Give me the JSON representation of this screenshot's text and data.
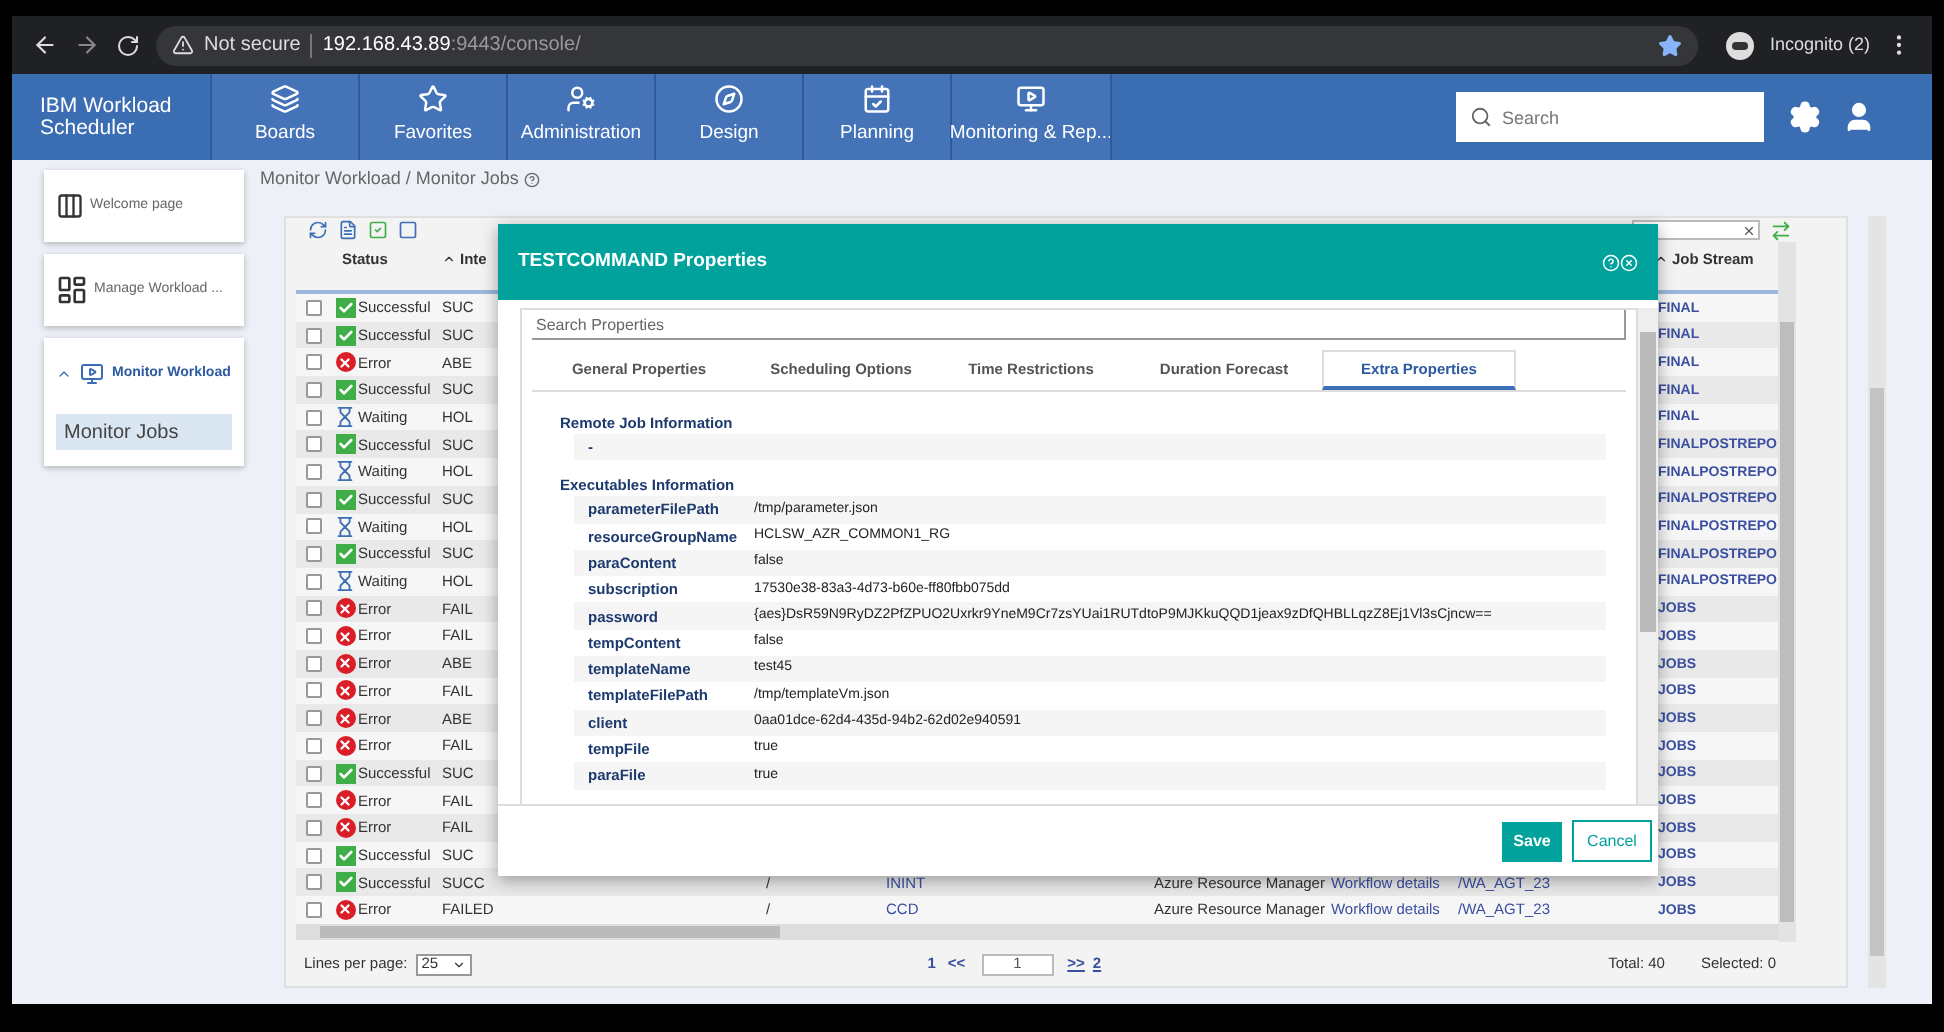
{
  "browser": {
    "security": "Not secure",
    "host": "192.168.43.89",
    "path": ":9443/console/",
    "profile": "Incognito (2)"
  },
  "app": {
    "name": "IBM Workload Scheduler"
  },
  "nav": [
    {
      "label": "Boards",
      "kind": "boards"
    },
    {
      "label": "Favorites",
      "kind": "favorites"
    },
    {
      "label": "Administration",
      "kind": "administration"
    },
    {
      "label": "Design",
      "kind": "design"
    },
    {
      "label": "Planning",
      "kind": "planning"
    },
    {
      "label": "Monitoring & Rep...",
      "kind": "monitoring"
    }
  ],
  "search": {
    "placeholder": "Search"
  },
  "sidebar": [
    {
      "label": "Welcome page",
      "kind": "welcome"
    },
    {
      "label": "Manage Workload ...",
      "kind": "manage"
    },
    {
      "label": "Monitor Workload",
      "kind": "monitor",
      "expanded": true,
      "children": [
        {
          "label": "Monitor Jobs",
          "selected": true
        }
      ]
    }
  ],
  "breadcrumb": "Monitor Workload / Monitor Jobs",
  "table": {
    "columns": [
      {
        "label": "Status"
      },
      {
        "label": "Inte"
      },
      {
        "label": "Job Stream"
      }
    ],
    "rows": [
      {
        "checked": false,
        "kind": "success",
        "status": "Successful",
        "internal_status": "SUC",
        "job_stream": "FINAL"
      },
      {
        "checked": false,
        "kind": "success",
        "status": "Successful",
        "internal_status": "SUC",
        "job_stream": "FINAL"
      },
      {
        "checked": false,
        "kind": "error",
        "status": "Error",
        "internal_status": "ABE",
        "job_stream": "FINAL"
      },
      {
        "checked": false,
        "kind": "success",
        "status": "Successful",
        "internal_status": "SUC",
        "job_stream": "FINAL"
      },
      {
        "checked": false,
        "kind": "waiting",
        "status": "Waiting",
        "internal_status": "HOL",
        "job_stream": "FINAL"
      },
      {
        "checked": false,
        "kind": "success",
        "status": "Successful",
        "internal_status": "SUC",
        "job_stream": "FINALPOSTREPO"
      },
      {
        "checked": false,
        "kind": "waiting",
        "status": "Waiting",
        "internal_status": "HOL",
        "job_stream": "FINALPOSTREPO"
      },
      {
        "checked": false,
        "kind": "success",
        "status": "Successful",
        "internal_status": "SUC",
        "job_stream": "FINALPOSTREPO"
      },
      {
        "checked": false,
        "kind": "waiting",
        "status": "Waiting",
        "internal_status": "HOL",
        "job_stream": "FINALPOSTREPO"
      },
      {
        "checked": false,
        "kind": "success",
        "status": "Successful",
        "internal_status": "SUC",
        "job_stream": "FINALPOSTREPO"
      },
      {
        "checked": false,
        "kind": "waiting",
        "status": "Waiting",
        "internal_status": "HOL",
        "job_stream": "FINALPOSTREPO"
      },
      {
        "checked": false,
        "kind": "error",
        "status": "Error",
        "internal_status": "FAIL",
        "job_stream": "JOBS"
      },
      {
        "checked": false,
        "kind": "error",
        "status": "Error",
        "internal_status": "FAIL",
        "job_stream": "JOBS"
      },
      {
        "checked": false,
        "kind": "error",
        "status": "Error",
        "internal_status": "ABE",
        "job_stream": "JOBS"
      },
      {
        "checked": false,
        "kind": "error",
        "status": "Error",
        "internal_status": "FAIL",
        "job_stream": "JOBS"
      },
      {
        "checked": false,
        "kind": "error",
        "status": "Error",
        "internal_status": "ABE",
        "job_stream": "JOBS"
      },
      {
        "checked": false,
        "kind": "error",
        "status": "Error",
        "internal_status": "FAIL",
        "job_stream": "JOBS"
      },
      {
        "checked": false,
        "kind": "success",
        "status": "Successful",
        "internal_status": "SUC",
        "job_stream": "JOBS"
      },
      {
        "checked": false,
        "kind": "error",
        "status": "Error",
        "internal_status": "FAIL",
        "job_stream": "JOBS"
      },
      {
        "checked": false,
        "kind": "error",
        "status": "Error",
        "internal_status": "FAIL",
        "job_stream": "JOBS"
      },
      {
        "checked": false,
        "kind": "success",
        "status": "Successful",
        "internal_status": "SUC",
        "job_stream": "JOBS"
      },
      {
        "checked": false,
        "kind": "success",
        "status": "Successful",
        "internal_status": "SUCC",
        "column_3": "/",
        "column_4": "ININT",
        "column_5": "Azure Resource Manager",
        "column_5_link": "Workflow details",
        "column_6": "/WA_AGT_23",
        "job_stream": "JOBS"
      },
      {
        "checked": false,
        "kind": "error",
        "status": "Error",
        "internal_status": "FAILED",
        "column_3": "/",
        "column_4": "CCD",
        "column_5": "Azure Resource Manager",
        "column_5_link": "Workflow details",
        "column_6": "/WA_AGT_23",
        "job_stream": "JOBS"
      }
    ]
  },
  "pagination": {
    "lines_label": "Lines per page:",
    "lines_value": "25",
    "first": "1",
    "prev": "<<",
    "page": "1",
    "next": ">>",
    "last": "2",
    "total": "Total: 40",
    "selected": "Selected: 0"
  },
  "dialog": {
    "title": "TESTCOMMAND Properties",
    "search_placeholder": "Search Properties",
    "tabs": [
      {
        "label": "General Properties",
        "selected": false
      },
      {
        "label": "Scheduling Options",
        "selected": false
      },
      {
        "label": "Time Restrictions",
        "selected": false
      },
      {
        "label": "Duration Forecast",
        "selected": false
      },
      {
        "label": "Extra Properties",
        "selected": true
      }
    ],
    "sections": [
      {
        "title": "Remote Job Information",
        "rows": [
          {
            "key": "-"
          }
        ]
      },
      {
        "title": "Executables Information",
        "rows": [
          {
            "key": "parameterFilePath",
            "value": "/tmp/parameter.json"
          },
          {
            "key": "resourceGroupName",
            "value": "HCLSW_AZR_COMMON1_RG"
          },
          {
            "key": "paraContent",
            "value": "false"
          },
          {
            "key": "subscription",
            "value": "17530e38-83a3-4d73-b60e-ff80fbb075dd"
          },
          {
            "key": "password",
            "value": "{aes}DsR59N9RyDZ2PfZPUO2Uxrkr9YneM9Cr7zsYUai1RUTdtoP9MJKkuQQD1jeax9zDfQHBLLqzZ8Ej1Vl3sCjncw=="
          },
          {
            "key": "tempContent",
            "value": "false"
          },
          {
            "key": "templateName",
            "value": "test45"
          },
          {
            "key": "templateFilePath",
            "value": "/tmp/templateVm.json"
          },
          {
            "key": "client",
            "value": "0aa01dce-62d4-435d-94b2-62d02e940591"
          },
          {
            "key": "tempFile",
            "value": "true"
          },
          {
            "key": "paraFile",
            "value": "true"
          }
        ]
      }
    ],
    "save": "Save",
    "cancel": "Cancel"
  }
}
